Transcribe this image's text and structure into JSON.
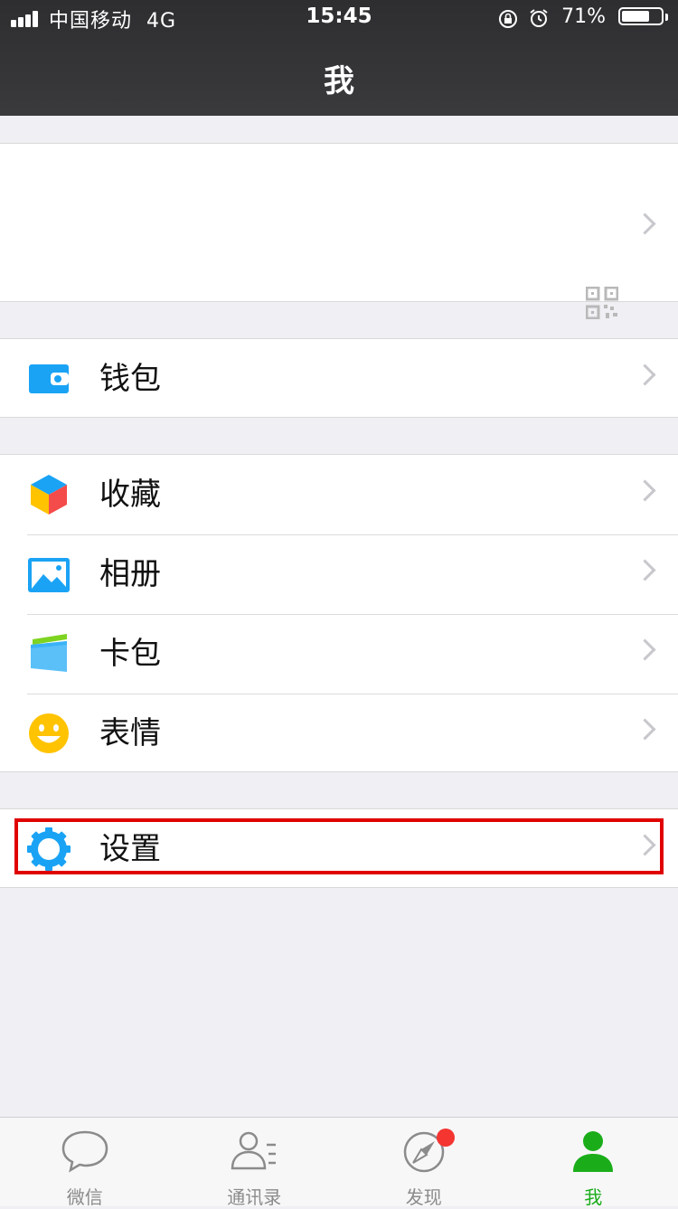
{
  "status": {
    "carrier": "中国移动",
    "network": "4G",
    "time": "15:45",
    "battery_pct": "71%",
    "battery_level": 0.71
  },
  "nav": {
    "title": "我"
  },
  "profile": {
    "qr_icon": "qr-code-icon"
  },
  "menu": {
    "wallet": {
      "label": "钱包",
      "icon": "wallet-icon",
      "color": "#1aa3f5"
    },
    "favorites": {
      "label": "收藏",
      "icon": "cube-icon"
    },
    "album": {
      "label": "相册",
      "icon": "photo-icon",
      "color": "#1aa3f5"
    },
    "cards": {
      "label": "卡包",
      "icon": "card-icon"
    },
    "stickers": {
      "label": "表情",
      "icon": "smiley-icon",
      "color": "#ffc300"
    },
    "settings": {
      "label": "设置",
      "icon": "gear-icon",
      "color": "#1aa3f5"
    }
  },
  "tabs": [
    {
      "label": "微信",
      "icon": "chat-icon"
    },
    {
      "label": "通讯录",
      "icon": "contacts-icon"
    },
    {
      "label": "发现",
      "icon": "compass-icon",
      "badge": true
    },
    {
      "label": "我",
      "icon": "me-icon",
      "active": true
    }
  ],
  "colors": {
    "accent": "#1aad19",
    "highlight": "#e00000",
    "badge": "#f43530"
  }
}
